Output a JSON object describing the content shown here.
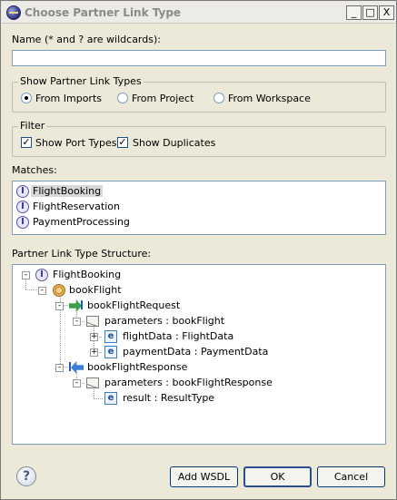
{
  "window": {
    "title": "Choose Partner Link Type"
  },
  "title_buttons": {
    "minimize": "_",
    "maximize": "□",
    "close": "X"
  },
  "name_field": {
    "label": "Name (* and ? are wildcards):",
    "value": "",
    "placeholder": ""
  },
  "show_group": {
    "legend": "Show Partner Link Types",
    "options": [
      {
        "label": "From Imports",
        "selected": true
      },
      {
        "label": "From Project",
        "selected": false
      },
      {
        "label": "From Workspace",
        "selected": false
      }
    ]
  },
  "filter_group": {
    "legend": "Filter",
    "checkboxes": [
      {
        "label": "Show Port Types",
        "checked": true
      },
      {
        "label": "Show Duplicates",
        "checked": true
      }
    ]
  },
  "matches": {
    "label": "Matches:",
    "items": [
      {
        "label": "FlightBooking",
        "icon": "interface-icon",
        "selected": true
      },
      {
        "label": "FlightReservation",
        "icon": "interface-icon",
        "selected": false
      },
      {
        "label": "PaymentProcessing",
        "icon": "interface-icon",
        "selected": false
      }
    ]
  },
  "structure": {
    "label": "Partner Link Type Structure:",
    "nodes": [
      {
        "label": "FlightBooking",
        "icon": "interface-icon",
        "expander": "-"
      },
      {
        "label": "bookFlight",
        "icon": "operation-icon",
        "expander": "-"
      },
      {
        "label": "bookFlightRequest",
        "icon": "input-message-icon",
        "expander": "-"
      },
      {
        "label": "parameters : bookFlight",
        "icon": "message-part-icon",
        "expander": "-"
      },
      {
        "label": "flightData : FlightData",
        "icon": "element-icon",
        "expander": "+"
      },
      {
        "label": "paymentData : PaymentData",
        "icon": "element-icon",
        "expander": "+"
      },
      {
        "label": "bookFlightResponse",
        "icon": "output-message-icon",
        "expander": "-"
      },
      {
        "label": "parameters : bookFlightResponse",
        "icon": "message-part-icon",
        "expander": "-"
      },
      {
        "label": "result : ResultType",
        "icon": "element-icon",
        "expander": ""
      }
    ]
  },
  "buttons": {
    "help": "?",
    "add_wsdl": "Add WSDL",
    "ok": "OK",
    "cancel": "Cancel"
  },
  "icon_glyphs": {
    "interface": "I",
    "element": "e"
  }
}
